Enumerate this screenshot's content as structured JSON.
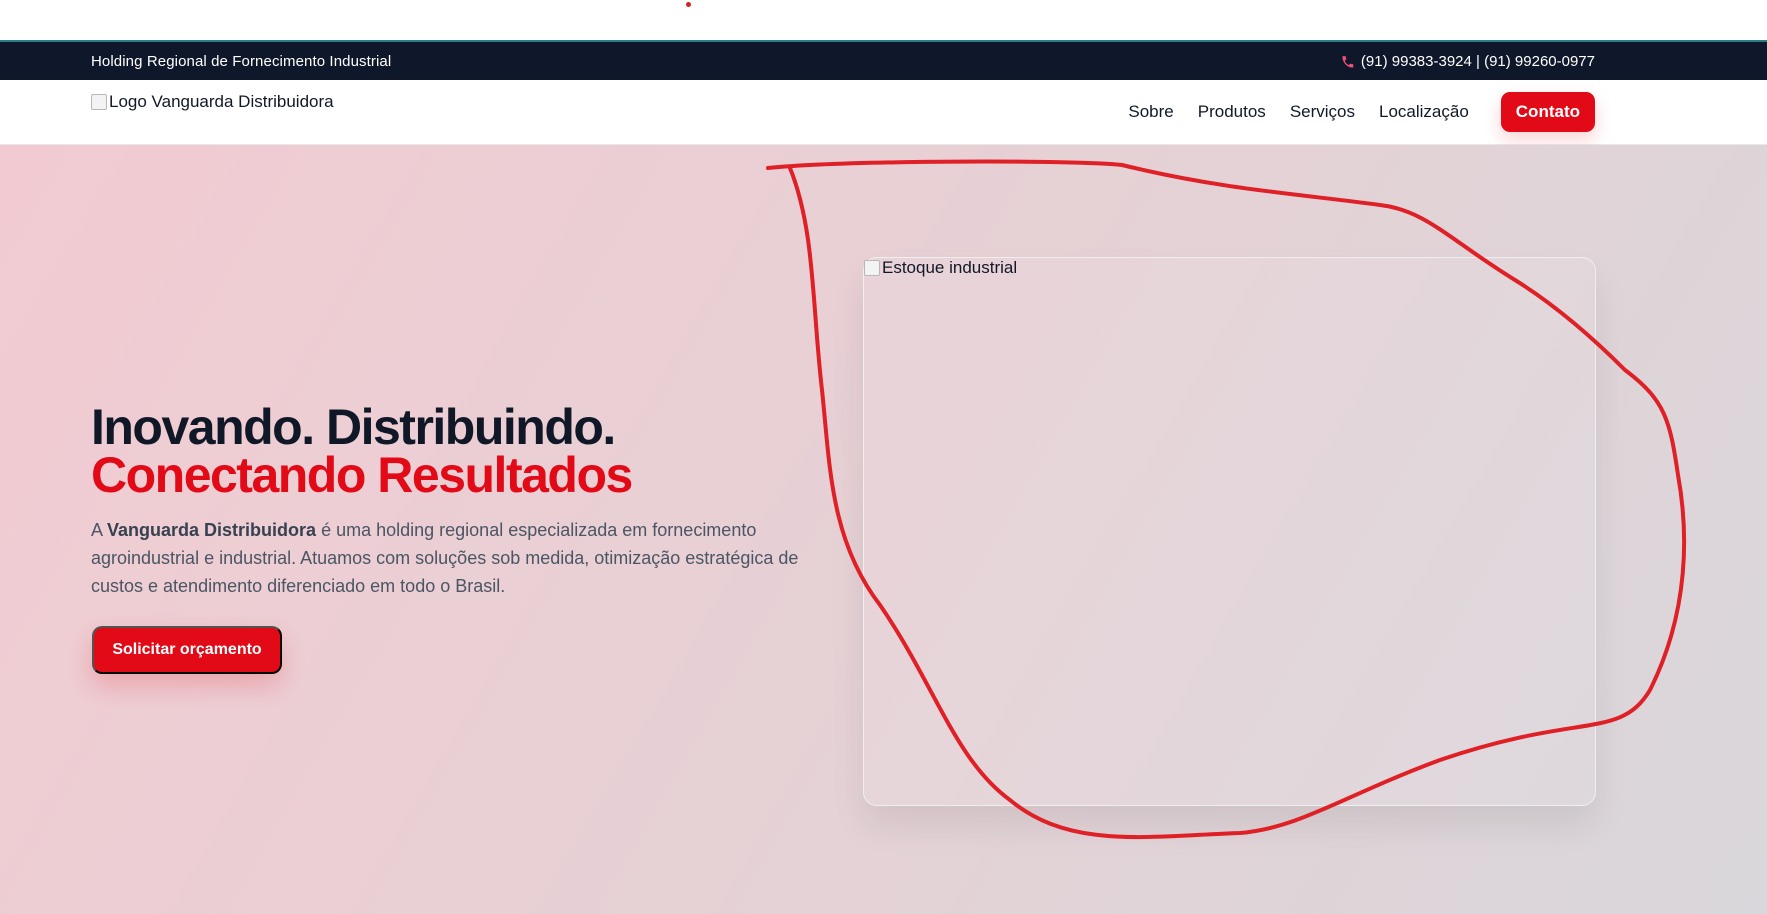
{
  "topbar": {
    "tagline": "Holding Regional de Fornecimento Industrial",
    "phone_text": "(91) 99383-3924 | (91) 99260-0977",
    "phone_icon": "phone-icon"
  },
  "header": {
    "logo_alt": "Logo Vanguarda Distribuidora",
    "nav": {
      "about": "Sobre",
      "products": "Produtos",
      "services": "Serviços",
      "location": "Localização",
      "contact": "Contato"
    }
  },
  "hero": {
    "title_line1": "Inovando. Distribuindo.",
    "title_line2": "Conectando Resultados",
    "description_prefix": "A ",
    "company_name": "Vanguarda Distribuidora",
    "description_suffix": " é uma holding regional especializada em fornecimento agroindustrial e industrial. Atuamos com soluções sob medida, otimização estratégica de custos e atendimento diferenciado em todo o Brasil.",
    "button_label": "Solicitar orçamento",
    "image_alt": "Estoque industrial"
  },
  "colors": {
    "brand_red": "#e20a17",
    "navy": "#0f172a",
    "annotation_red": "#df2026"
  }
}
